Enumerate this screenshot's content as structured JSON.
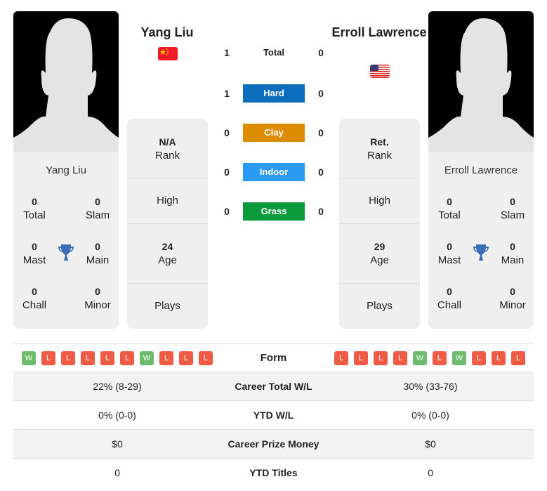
{
  "player1": {
    "name": "Yang Liu",
    "country": "China",
    "flag_icon": "china-flag-icon",
    "card_name": "Yang Liu",
    "titles": {
      "total": {
        "value": "0",
        "label": "Total"
      },
      "slam": {
        "value": "0",
        "label": "Slam"
      },
      "mast": {
        "value": "0",
        "label": "Mast"
      },
      "main": {
        "value": "0",
        "label": "Main"
      },
      "chall": {
        "value": "0",
        "label": "Chall"
      },
      "minor": {
        "value": "0",
        "label": "Minor"
      }
    },
    "info": {
      "rank": {
        "value": "N/A",
        "label": "Rank"
      },
      "high": {
        "value": "",
        "label": "High"
      },
      "age": {
        "value": "24",
        "label": "Age"
      },
      "plays": {
        "value": "",
        "label": "Plays"
      }
    },
    "form": [
      "W",
      "L",
      "L",
      "L",
      "L",
      "L",
      "W",
      "L",
      "L",
      "L"
    ],
    "career_wl": "22% (8-29)",
    "ytd_wl": "0% (0-0)",
    "prize_money": "$0",
    "ytd_titles": "0"
  },
  "player2": {
    "name": "Erroll Lawrence",
    "country": "USA",
    "flag_icon": "usa-flag-icon",
    "card_name": "Erroll Lawrence",
    "titles": {
      "total": {
        "value": "0",
        "label": "Total"
      },
      "slam": {
        "value": "0",
        "label": "Slam"
      },
      "mast": {
        "value": "0",
        "label": "Mast"
      },
      "main": {
        "value": "0",
        "label": "Main"
      },
      "chall": {
        "value": "0",
        "label": "Chall"
      },
      "minor": {
        "value": "0",
        "label": "Minor"
      }
    },
    "info": {
      "rank": {
        "value": "Ret.",
        "label": "Rank"
      },
      "high": {
        "value": "",
        "label": "High"
      },
      "age": {
        "value": "29",
        "label": "Age"
      },
      "plays": {
        "value": "",
        "label": "Plays"
      }
    },
    "form": [
      "L",
      "L",
      "L",
      "L",
      "W",
      "L",
      "W",
      "L",
      "L",
      "L"
    ],
    "career_wl": "30% (33-76)",
    "ytd_wl": "0% (0-0)",
    "prize_money": "$0",
    "ytd_titles": "0"
  },
  "h2h": [
    {
      "label": "Total",
      "p1": "1",
      "p2": "0",
      "color": ""
    },
    {
      "label": "Hard",
      "p1": "1",
      "p2": "0",
      "color": "#0a6ebd"
    },
    {
      "label": "Clay",
      "p1": "0",
      "p2": "0",
      "color": "#dd8c00"
    },
    {
      "label": "Indoor",
      "p1": "0",
      "p2": "0",
      "color": "#2b9af3"
    },
    {
      "label": "Grass",
      "p1": "0",
      "p2": "0",
      "color": "#0b9a3c"
    }
  ],
  "labels": {
    "form": "Form",
    "career_wl": "Career Total W/L",
    "ytd_wl": "YTD W/L",
    "prize_money": "Career Prize Money",
    "ytd_titles": "YTD Titles"
  },
  "colors": {
    "win": "#6dbb6d",
    "loss": "#ef5b45",
    "trophy": "#3a6fb8"
  }
}
